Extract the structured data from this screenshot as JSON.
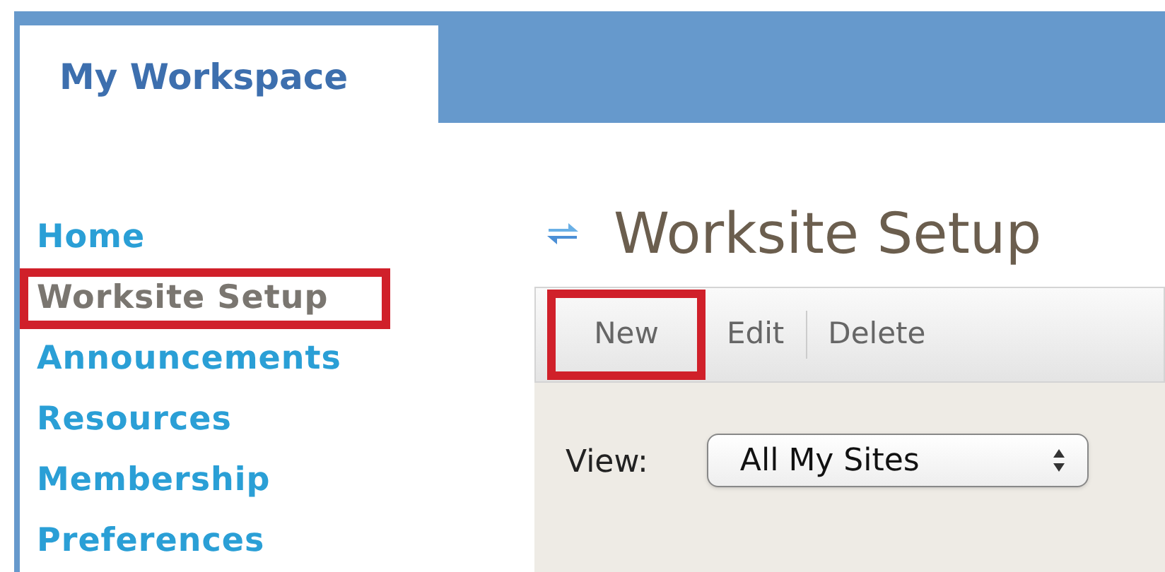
{
  "site_tabs": [
    {
      "label": "My Workspace",
      "selected": true
    }
  ],
  "sidebar": {
    "items": [
      {
        "label": "Home",
        "selected": false,
        "highlighted": false
      },
      {
        "label": "Worksite Setup",
        "selected": true,
        "highlighted": true
      },
      {
        "label": "Announcements",
        "selected": false,
        "highlighted": false
      },
      {
        "label": "Resources",
        "selected": false,
        "highlighted": false
      },
      {
        "label": "Membership",
        "selected": false,
        "highlighted": false
      },
      {
        "label": "Preferences",
        "selected": false,
        "highlighted": false
      }
    ]
  },
  "page": {
    "title": "Worksite Setup",
    "toolbar": [
      {
        "label": "New",
        "highlighted": true
      },
      {
        "label": "Edit",
        "highlighted": false
      },
      {
        "label": "Delete",
        "highlighted": false
      }
    ],
    "view": {
      "label": "View:",
      "value": "All My Sites"
    }
  }
}
